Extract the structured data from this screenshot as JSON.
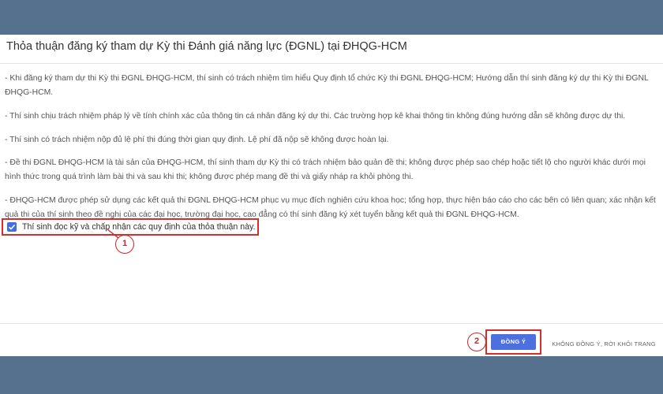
{
  "dialog": {
    "title": "Thỏa thuận đăng ký tham dự Kỳ thi Đánh giá năng lực (ĐGNL) tại ĐHQG-HCM",
    "paragraphs": [
      "- Khi đăng ký tham dự thi Kỳ thi ĐGNL ĐHQG-HCM, thí sinh có trách nhiệm tìm hiểu Quy định tổ chức Kỳ thi ĐGNL ĐHQG-HCM; Hướng dẫn thí sinh đăng ký dự thi Kỳ thi ĐGNL ĐHQG-HCM.",
      "- Thí sinh chịu trách nhiệm pháp lý về tính chính xác của thông tin cá nhân đăng ký dự thi. Các trường hợp kê khai thông tin không đúng hướng dẫn sẽ không được dự thi.",
      "- Thí sinh có trách nhiệm nộp đủ lệ phí thi đúng thời gian quy định. Lệ phí đã nộp sẽ không được hoàn lại.",
      "- Đề thi ĐGNL ĐHQG-HCM là tài sản của ĐHQG-HCM, thí sinh tham dự Kỳ thi có trách nhiệm bảo quản đề thi; không được phép sao chép hoặc tiết lộ cho người khác dưới mọi hình thức trong quá trình làm bài thi và sau khi thi; không được phép mang đề thi và giấy nháp ra khỏi phòng thi.",
      "- ĐHQG-HCM được phép sử dụng các kết quả thi ĐGNL ĐHQG-HCM phục vụ mục đích nghiên cứu khoa học; tổng hợp, thực hiện báo cáo cho các bên có liên quan; xác nhận kết quả thi của thí sinh theo đề nghị của các đại học, trường đại học, cao đẳng có thí sinh đăng ký xét tuyển bằng kết quả thi ĐGNL ĐHQG-HCM."
    ],
    "agree_checkbox": {
      "label": "Thí sinh đọc kỹ và chấp nhận các quy định của thỏa thuận này.",
      "checked": true
    },
    "buttons": {
      "agree": "ĐỒNG Ý",
      "decline": "KHÔNG ĐỒNG Ý, RỜI KHỎI TRANG"
    }
  },
  "annotations": {
    "marker_1": "1",
    "marker_2": "2",
    "highlight_color": "#d32f2f"
  },
  "colors": {
    "backdrop": "#56718e",
    "primary_button": "#4d6fe0",
    "checkbox": "#3f6fe0"
  }
}
